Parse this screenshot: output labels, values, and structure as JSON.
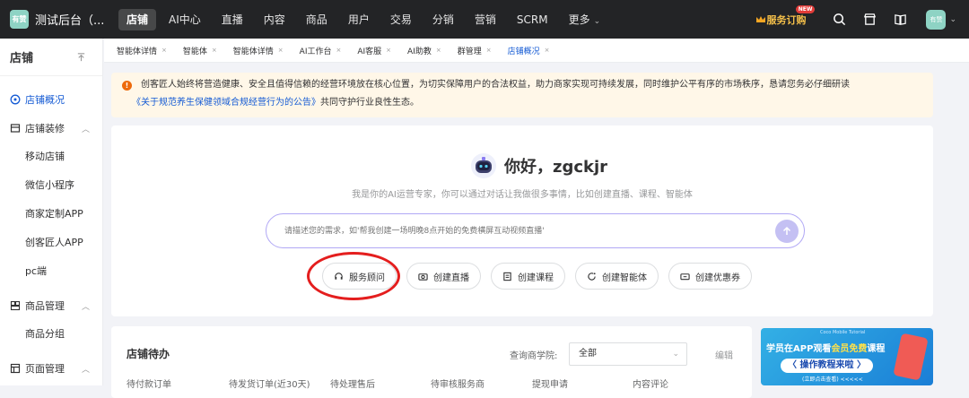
{
  "app": {
    "title": "测试后台（...",
    "logo_text": "有赞"
  },
  "nav": [
    "店铺",
    "AI中心",
    "直播",
    "内容",
    "商品",
    "用户",
    "交易",
    "分销",
    "营销",
    "SCRM",
    "更多"
  ],
  "topbar": {
    "service_label": "服务订购",
    "new_badge": "NEW",
    "avatar_text": "有赞"
  },
  "sidebar": {
    "title": "店铺",
    "overview": "店铺概况",
    "groups": [
      {
        "label": "店铺装修",
        "items": [
          "移动店铺",
          "微信小程序",
          "商家定制APP",
          "创客匠人APP",
          "pc端"
        ]
      },
      {
        "label": "商品管理",
        "items": [
          "商品分组"
        ]
      },
      {
        "label": "页面管理",
        "items": []
      }
    ]
  },
  "tabs": [
    "智能体详情",
    "智能体",
    "智能体详情",
    "AI工作台",
    "AI客服",
    "AI助教",
    "群管理",
    "店铺概况"
  ],
  "notice": {
    "line1": "创客匠人始终将营造健康、安全且值得信赖的经营环境放在核心位置，为切实保障用户的合法权益，助力商家实现可持续发展，同时维护公平有序的市场秩序，恳请您务必仔细研读",
    "link": "《关于规范养生保健领域合规经营行为的公告》",
    "line2_tail": "共同守护行业良性生态。"
  },
  "assistant": {
    "greeting": "你好，zgckjr",
    "subtitle": "我是你的AI运营专家，你可以通过对话让我做很多事情，比如创建直播、课程、智能体",
    "placeholder": "请描述您的需求，如'帮我创建一场明晚8点开始的免费横屏互动视频直播'",
    "quick_actions": [
      "服务顾问",
      "创建直播",
      "创建课程",
      "创建智能体",
      "创建优惠券"
    ]
  },
  "todo": {
    "title": "店铺待办",
    "query_label": "查询商学院:",
    "select_value": "全部",
    "edit": "编辑",
    "columns": [
      "待付款订单",
      "待发货订单(近30天)",
      "待处理售后",
      "待审核服务商",
      "提现申请",
      "内容评论"
    ]
  },
  "banner": {
    "pre": "Coco Mobile Tutorial",
    "line1a": "学员在APP观看",
    "line1b": "会员免费",
    "line1c": "课程",
    "line2": "〈 操作教程来啦 〉",
    "line3": "(立即点击查看) <<<<<"
  },
  "colors": {
    "topbar": "#232426",
    "accent": "#155bd4",
    "highlight_circle": "#e41e1e",
    "notice_bg": "#fff7e8"
  }
}
